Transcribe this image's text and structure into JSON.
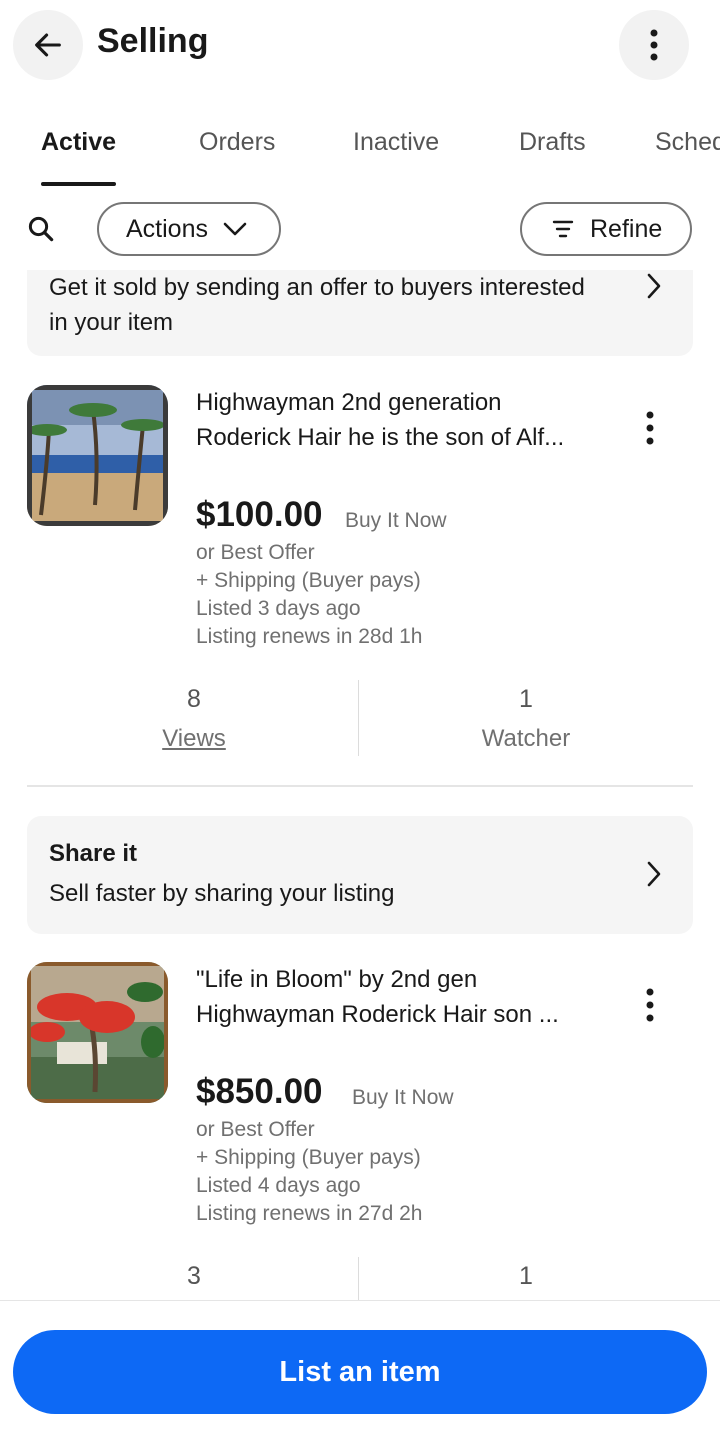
{
  "header": {
    "title": "Selling",
    "back_icon": "arrow-left-icon",
    "more_icon": "more-vertical-icon"
  },
  "tabs": [
    {
      "label": "Active"
    },
    {
      "label": "Orders"
    },
    {
      "label": "Inactive"
    },
    {
      "label": "Drafts"
    },
    {
      "label": "Scheduled"
    }
  ],
  "toolbar": {
    "actions_label": "Actions",
    "refine_label": "Refine"
  },
  "offer_banner": {
    "text": "Get it sold by sending an offer to buyers interested in your item"
  },
  "listings": [
    {
      "title": "Highwayman 2nd generation Roderick Hair he is the son of Alf...",
      "price": "$100.00",
      "format": "Buy It Now",
      "offer": "or Best Offer",
      "shipping": "+ Shipping (Buyer pays)",
      "listed": "Listed 3 days ago",
      "renews": "Listing renews in 28d 1h",
      "views_count": "8",
      "views_label": "Views",
      "watchers_count": "1",
      "watchers_label": "Watcher"
    },
    {
      "title": "\"Life in Bloom\" by 2nd gen Highwayman Roderick Hair son ...",
      "price": "$850.00",
      "format": "Buy It Now",
      "offer": "or Best Offer",
      "shipping": "+ Shipping (Buyer pays)",
      "listed": "Listed 4 days ago",
      "renews": "Listing renews in 27d 2h",
      "views_count": "3",
      "watchers_count": "1"
    }
  ],
  "share_banner": {
    "heading": "Share it",
    "text": "Sell faster by sharing your listing"
  },
  "bottom": {
    "cta_label": "List an item"
  },
  "colors": {
    "accent": "#0d69f5",
    "text": "#191919",
    "muted": "#707070",
    "banner_bg": "#f5f5f5"
  }
}
